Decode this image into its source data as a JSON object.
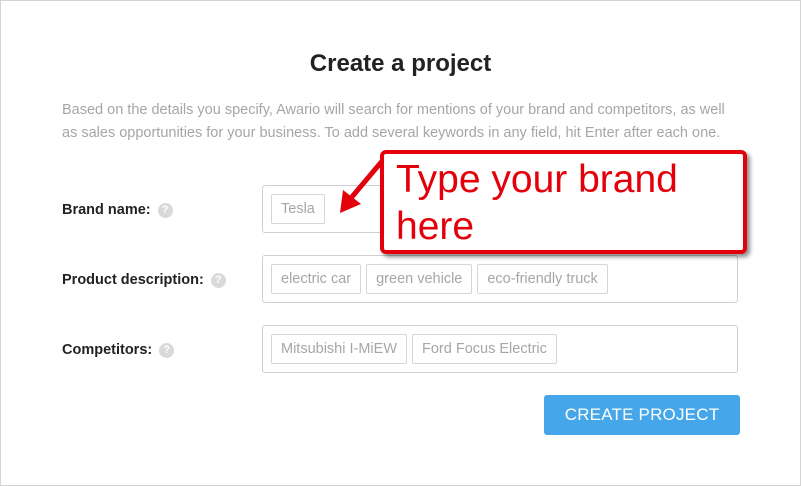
{
  "page": {
    "title": "Create a project",
    "intro": "Based on the details you specify, Awario will search for mentions of your brand and competitors, as well as sales opportunities for your business. To add several keywords in any field, hit Enter after each one."
  },
  "form": {
    "brand": {
      "label": "Brand name:",
      "tags": [
        "Tesla"
      ]
    },
    "product": {
      "label": "Product description:",
      "tags": [
        "electric car",
        "green vehicle",
        "eco-friendly truck"
      ]
    },
    "competitors": {
      "label": "Competitors:",
      "tags": [
        "Mitsubishi I-MiEW",
        "Ford Focus Electric"
      ]
    },
    "help_glyph": "?",
    "submit_label": "CREATE PROJECT"
  },
  "annotation": {
    "text_line1": "Type your brand",
    "text_line2": "here"
  },
  "colors": {
    "primary_button": "#45a7e9",
    "annotation_red": "#e3000b",
    "placeholder_gray": "#a6a6a6"
  }
}
